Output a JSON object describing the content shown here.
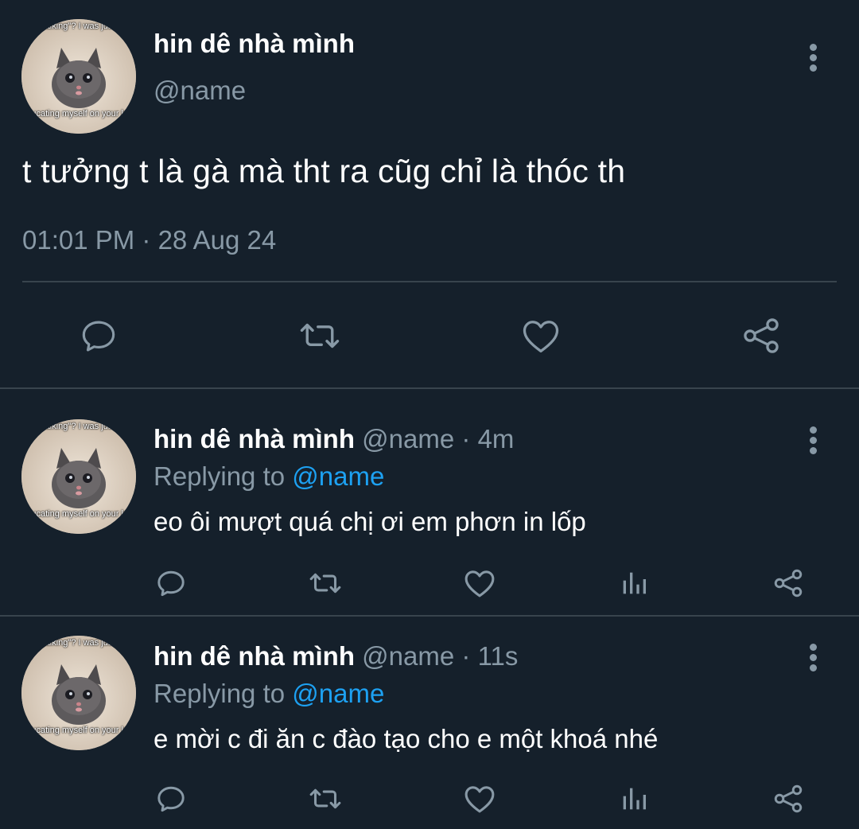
{
  "main_tweet": {
    "display_name": "hin dê nhà mình",
    "handle": "@name",
    "text": "t tưởng t là gà mà tht ra cũg chỉ là thóc th",
    "timestamp": "01:01 PM · 28 Aug 24",
    "avatar": {
      "caption_top": "talking\"? I was just",
      "caption_bottom": "educating myself on your lore"
    },
    "actions": [
      "reply-icon",
      "retweet-icon",
      "like-icon",
      "share-icon"
    ]
  },
  "replies": [
    {
      "display_name": "hin dê nhà mình",
      "handle": "@name",
      "time": "4m",
      "replying_label": "Replying to",
      "replying_to": "@name",
      "text": "eo ôi mượt quá chị ơi em phơn in lốp",
      "avatar": {
        "caption_top": "talking\"? I was just",
        "caption_bottom": "educating myself on your lore"
      }
    },
    {
      "display_name": "hin dê nhà mình",
      "handle": "@name",
      "time": "11s",
      "replying_label": "Replying to",
      "replying_to": "@name",
      "text": "e mời c đi ăn c đào tạo cho e một khoá nhé",
      "avatar": {
        "caption_top": "talking\"? I was just",
        "caption_bottom": "educating myself on your lore"
      }
    }
  ],
  "colors": {
    "background": "#15202b",
    "primary_text": "#ffffff",
    "secondary_text": "#8899a6",
    "mention": "#1da1f2",
    "divider": "#38444d"
  }
}
